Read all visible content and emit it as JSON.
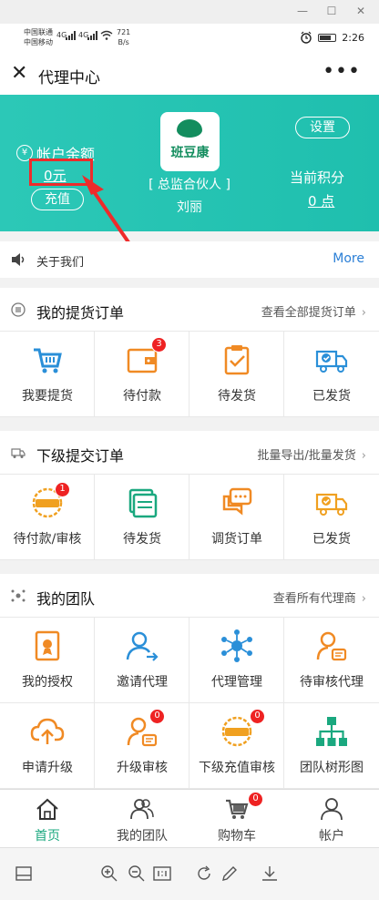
{
  "status": {
    "carrier1": "中国联通",
    "carrier2": "中国移动",
    "net1": "4G",
    "net2": "4G",
    "speed_value": "721",
    "speed_unit": "B/s",
    "time": "2:26"
  },
  "titlebar": {
    "title": "代理中心"
  },
  "header": {
    "balance_label": "帐户余额",
    "balance_value": "0元",
    "recharge_label": "充值",
    "brand": "班豆康",
    "role": "[ 总监合伙人 ]",
    "name": "刘丽",
    "settings_label": "设置",
    "points_label": "当前积分",
    "points_value": "0 点"
  },
  "notice": {
    "text": "关于我们",
    "more": "More"
  },
  "my_orders": {
    "title": "我的提货订单",
    "link": "查看全部提货订单",
    "items": [
      {
        "label": "我要提货",
        "icon": "cart-icon"
      },
      {
        "label": "待付款",
        "icon": "wallet-icon",
        "badge": "3"
      },
      {
        "label": "待发货",
        "icon": "clipboard-check-icon"
      },
      {
        "label": "已发货",
        "icon": "truck-check-icon"
      }
    ]
  },
  "sub_orders": {
    "title": "下级提交订单",
    "link": "批量导出/批量发货",
    "items": [
      {
        "label": "待付款/审核",
        "icon": "stamp-icon",
        "badge": "1"
      },
      {
        "label": "待发货",
        "icon": "stack-icon"
      },
      {
        "label": "调货订单",
        "icon": "chat-icon"
      },
      {
        "label": "已发货",
        "icon": "truck-check-icon"
      }
    ]
  },
  "team": {
    "title": "我的团队",
    "link": "查看所有代理商",
    "items": [
      {
        "label": "我的授权",
        "icon": "certificate-icon"
      },
      {
        "label": "邀请代理",
        "icon": "user-invite-icon"
      },
      {
        "label": "代理管理",
        "icon": "network-icon"
      },
      {
        "label": "待审核代理",
        "icon": "user-card-icon"
      },
      {
        "label": "申请升级",
        "icon": "cloud-upload-icon"
      },
      {
        "label": "升级审核",
        "icon": "user-card-icon",
        "badge": "0"
      },
      {
        "label": "下级充值审核",
        "icon": "stamp-icon",
        "badge": "0"
      },
      {
        "label": "团队树形图",
        "icon": "org-tree-icon"
      }
    ]
  },
  "tabbar": {
    "items": [
      {
        "label": "首页",
        "icon": "home-icon"
      },
      {
        "label": "我的团队",
        "icon": "team-icon"
      },
      {
        "label": "购物车",
        "icon": "cart-icon",
        "badge": "0"
      },
      {
        "label": "帐户",
        "icon": "user-icon"
      }
    ]
  },
  "colors": {
    "banner": "#22c4b2",
    "active_tab": "#1aa87f",
    "badge": "#e22222",
    "link_blue": "#2b7fd6"
  }
}
